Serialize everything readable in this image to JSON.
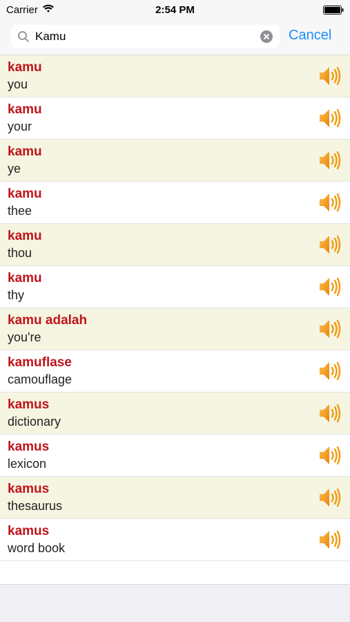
{
  "status": {
    "carrier": "Carrier",
    "time": "2:54 PM"
  },
  "search": {
    "value": "Kamu",
    "cancel_label": "Cancel"
  },
  "results": [
    {
      "word": "kamu",
      "meaning": "you"
    },
    {
      "word": "kamu",
      "meaning": "your"
    },
    {
      "word": "kamu",
      "meaning": "ye"
    },
    {
      "word": "kamu",
      "meaning": "thee"
    },
    {
      "word": "kamu",
      "meaning": "thou"
    },
    {
      "word": "kamu",
      "meaning": "thy"
    },
    {
      "word": "kamu adalah",
      "meaning": "you're"
    },
    {
      "word": "kamuflase",
      "meaning": "camouflage"
    },
    {
      "word": "kamus",
      "meaning": "dictionary"
    },
    {
      "word": "kamus",
      "meaning": "lexicon"
    },
    {
      "word": "kamus",
      "meaning": "thesaurus"
    },
    {
      "word": "kamus",
      "meaning": "word book"
    }
  ],
  "icons": {
    "speaker": "speaker-icon",
    "search": "search-icon",
    "clear": "clear-icon"
  },
  "colors": {
    "word": "#c0131b",
    "accent": "#1a8cff",
    "row_alt": "#f5f5e2",
    "speaker": "#f39c12"
  }
}
